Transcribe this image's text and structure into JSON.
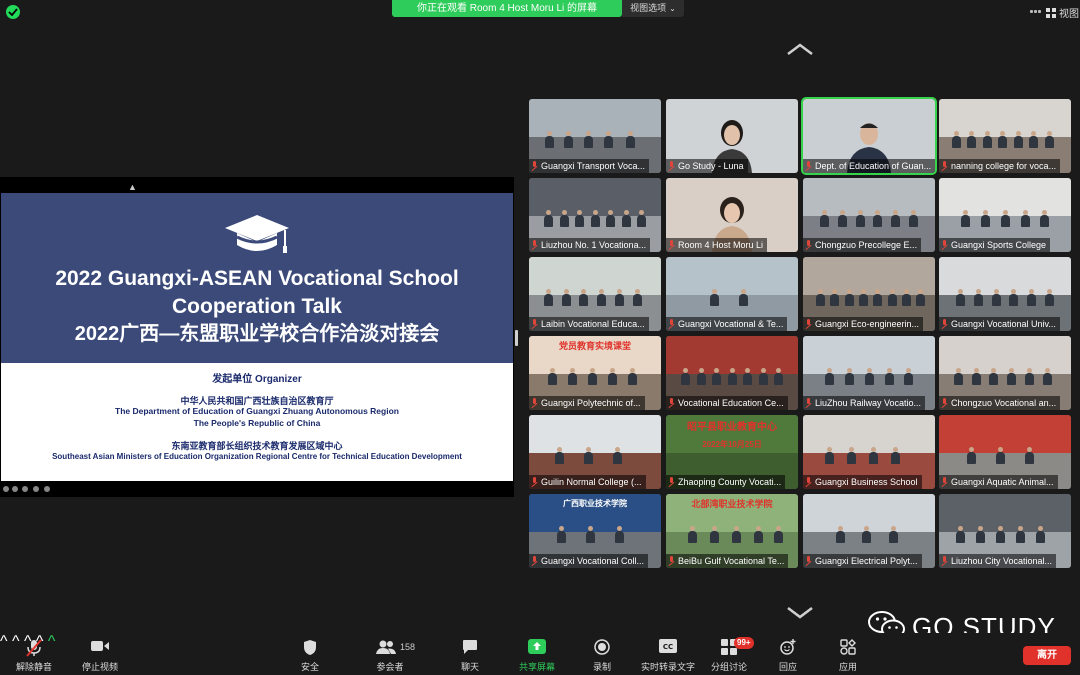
{
  "topbar": {
    "viewing_banner": "你正在观看 Room 4 Host Moru Li 的屏幕",
    "view_options_label": "视图选项",
    "view_label": "视图"
  },
  "slide": {
    "title_en_line1": "2022 Guangxi-ASEAN Vocational School",
    "title_en_line2": "Cooperation Talk",
    "title_zh": "2022广西—东盟职业学校合作洽淡对接会",
    "organizer_heading": "发起单位 Organizer",
    "org1_zh": "中华人民共和国广西壮族自治区教育厅",
    "org1_en": "The Department of Education of Guangxi Zhuang Autonomous Region",
    "org1_country": "The People's Republic of China",
    "org2_zh": "东南亚教育部长组织技术教育发展区域中心",
    "org2_en": "Southeast Asian Ministers of Education Organization Regional Centre for Technical Education Development"
  },
  "participants": [
    {
      "name": "Guangxi Transport Voca..."
    },
    {
      "name": "Go Study - Luna"
    },
    {
      "name": "Dept. of Education of Guan..."
    },
    {
      "name": "nanning college for voca..."
    },
    {
      "name": "Liuzhou No. 1 Vocationa..."
    },
    {
      "name": "Room 4 Host Moru Li"
    },
    {
      "name": "Chongzuo Precollege E..."
    },
    {
      "name": "Guangxi  Sports  College"
    },
    {
      "name": "Laibin Vocational Educa..."
    },
    {
      "name": "Guangxi Vocational & Te..."
    },
    {
      "name": "Guangxi Eco-engineerin..."
    },
    {
      "name": "Guangxi Vocational Univ..."
    },
    {
      "name": "Guangxi Polytechnic of..."
    },
    {
      "name": "Vocational Education Ce..."
    },
    {
      "name": "LiuZhou Railway Vocatio..."
    },
    {
      "name": "Chongzuo Vocational an..."
    },
    {
      "name": "Guilin Normal College  (..."
    },
    {
      "name": "Zhaoping County Vocati..."
    },
    {
      "name": "Guangxi Business School"
    },
    {
      "name": "Guangxi Aquatic Animal..."
    },
    {
      "name": "Guangxi Vocational Coll..."
    },
    {
      "name": "BeiBu Gulf Vocational Te..."
    },
    {
      "name": "Guangxi Electrical Polyt..."
    },
    {
      "name": "Liuzhou City Vocational..."
    }
  ],
  "tile_banners": {
    "tile12": "党员教育实境课堂",
    "tile17_line1": "昭平县职业教育中心",
    "tile17_line2": "2022年10月25日",
    "tile21": "北部湾职业技术学院",
    "tile20": "广西职业技术学院"
  },
  "watermark": "GO STUDY",
  "toolbar": {
    "unmute": "解除静音",
    "stop_video": "停止视频",
    "security": "安全",
    "participants": "参会者",
    "participants_count": "158",
    "chat": "聊天",
    "share_screen": "共享屏幕",
    "record": "录制",
    "live_transcript": "实时转录文字",
    "breakout_rooms": "分组讨论",
    "breakout_badge": "99+",
    "reactions": "回应",
    "apps": "应用",
    "leave": "离开"
  },
  "colors": {
    "banner_green": "#2ecc5a",
    "active_tile_border": "#36d34b",
    "slide_navy": "#3b4a79",
    "leave_red": "#e0322a",
    "share_green": "#2ecc5a"
  }
}
